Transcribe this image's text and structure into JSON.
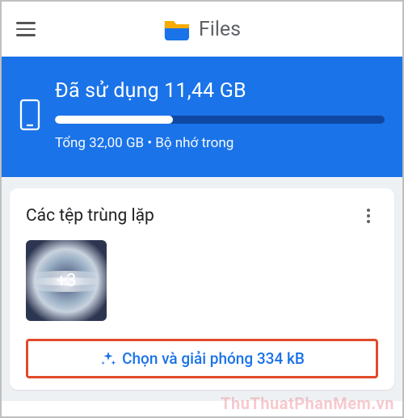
{
  "app": {
    "title": "Files"
  },
  "storage": {
    "used_text": "Đã sử dụng 11,44 GB",
    "total_text": "Tổng 32,00 GB • Bộ nhớ trong",
    "used_gb": 11.44,
    "total_gb": 32.0,
    "used_percent": 35.75
  },
  "card": {
    "title": "Các tệp trùng lặp",
    "thumb_badge": "+3",
    "cta": "Chọn và giải phóng 334 kB"
  },
  "watermark": "ThuThuatPhanMem.vn",
  "colors": {
    "brand_blue": "#1a73e8",
    "highlight_red": "#e04a2a"
  }
}
